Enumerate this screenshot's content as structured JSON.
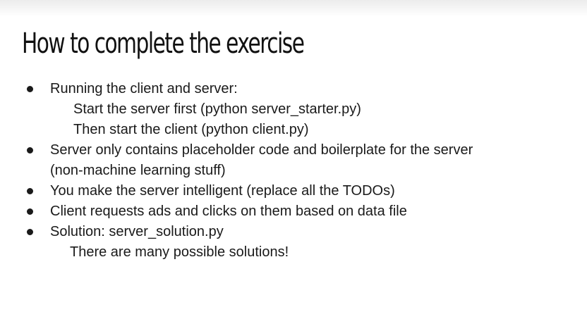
{
  "slide": {
    "title": "How to complete the exercise",
    "bullets": [
      {
        "text": "Running the client and server:",
        "sub": [
          "Start the server first (python server_starter.py)",
          "Then start the client (python client.py)"
        ]
      },
      {
        "text": "Server only contains placeholder code and boilerplate for the server",
        "continuation": "(non-machine learning stuff)"
      },
      {
        "text": "You make the server intelligent (replace all the TODOs)"
      },
      {
        "text": "Client requests ads and clicks on them based on data file"
      },
      {
        "text": "Solution: server_solution.py",
        "sub": [
          "There are many possible solutions!"
        ]
      }
    ]
  }
}
